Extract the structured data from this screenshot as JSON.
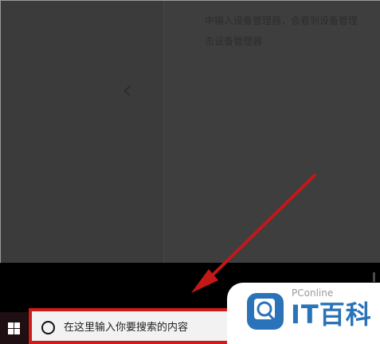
{
  "background_doc": {
    "text_line1": "中输入设备管理器，会看到设备管理",
    "text_line2": "击设备管理器",
    "nav_glyph": "‹"
  },
  "taskbar": {
    "search": {
      "placeholder": "在这里输入你要搜索的内容"
    }
  },
  "watermark": {
    "sub_label": "PConline",
    "main_label": "IT百科"
  },
  "colors": {
    "highlight_red": "#d11a1a",
    "arrow_red": "#c31818",
    "brand_blue": "#2b73b9"
  },
  "icons": {
    "start": "windows-logo-icon",
    "search": "search-circle-icon",
    "annotation": "red-arrow-icon",
    "watermark": "magnifier-logo-icon"
  }
}
